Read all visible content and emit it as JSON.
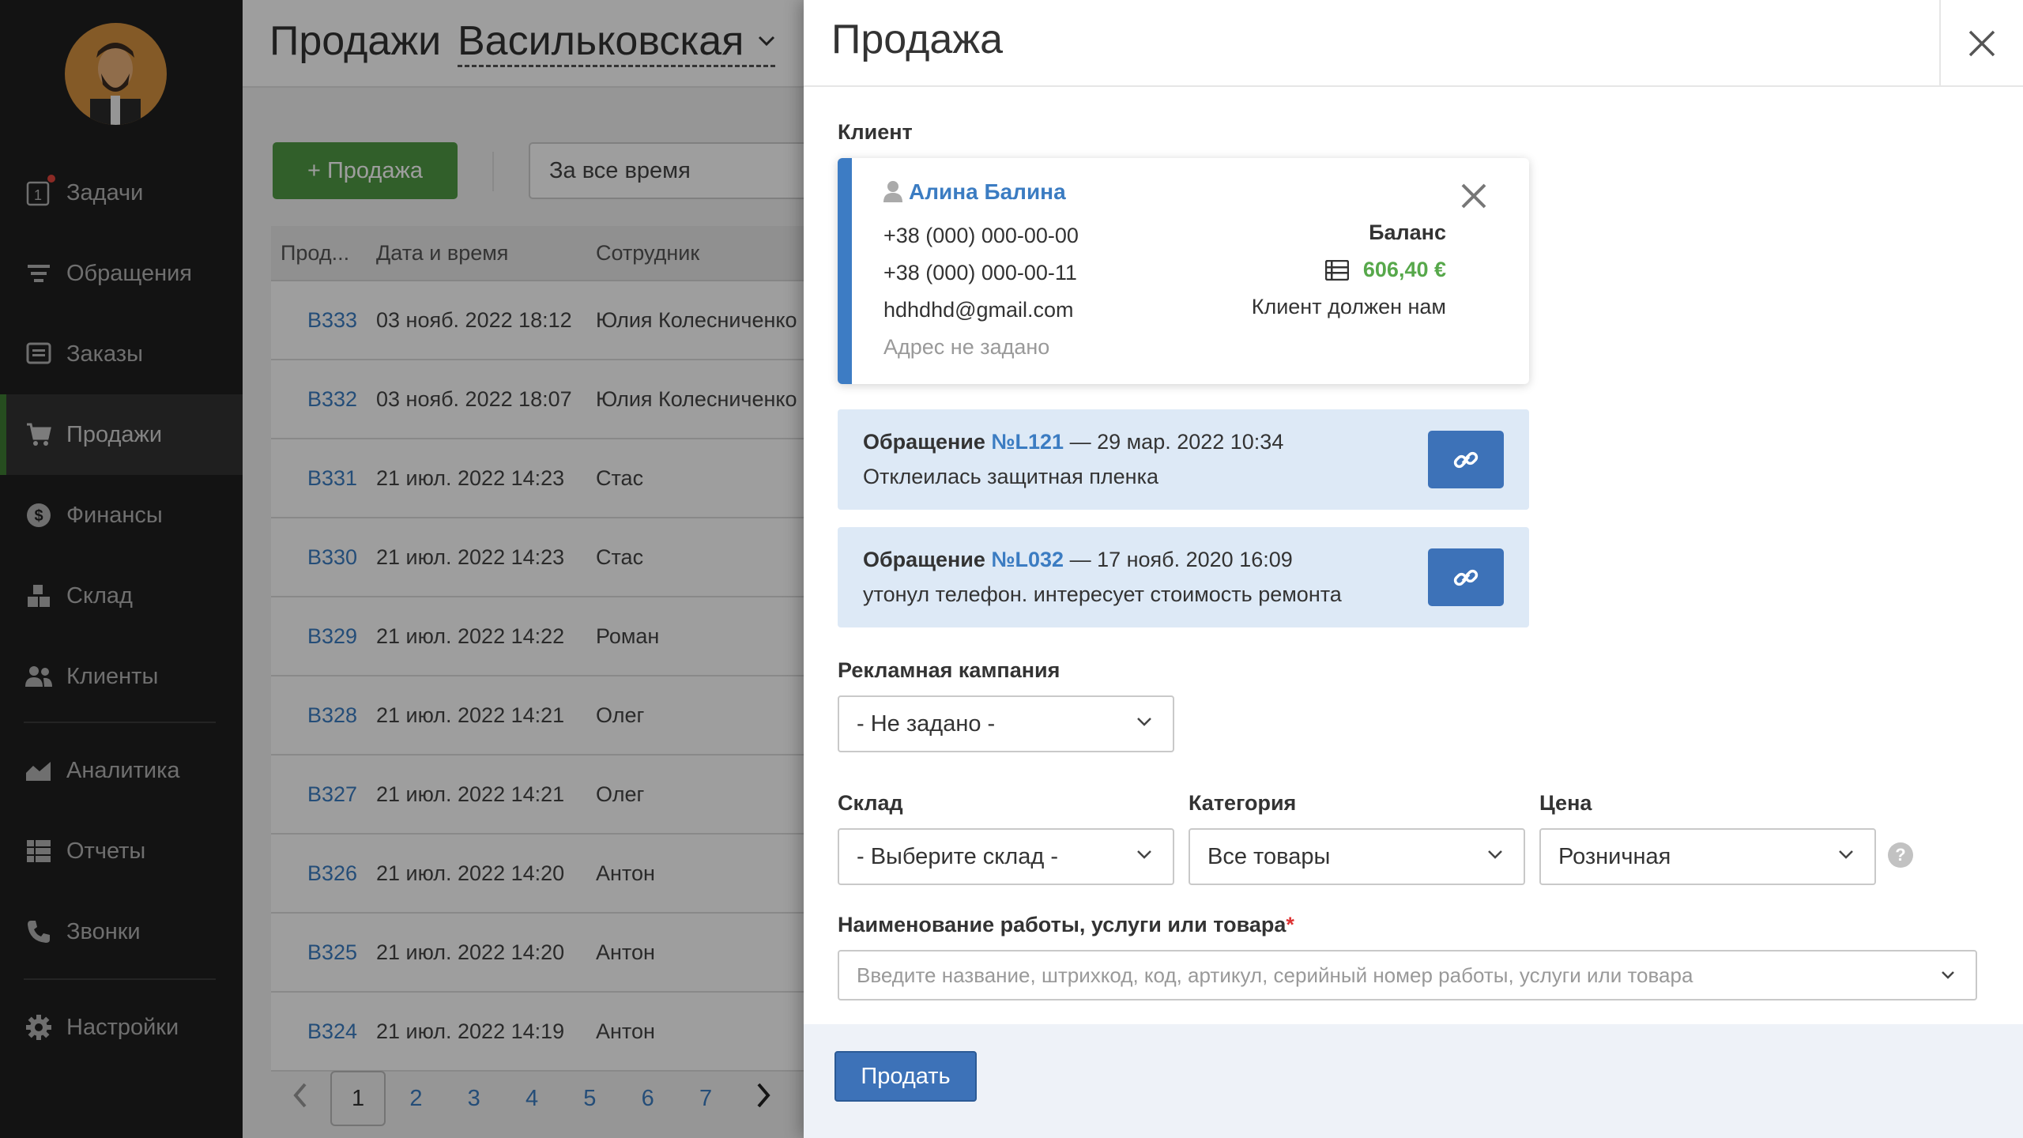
{
  "sidebar": {
    "items": [
      {
        "label": "Задачи",
        "icon": "tasks-icon"
      },
      {
        "label": "Обращения",
        "icon": "appeals-icon"
      },
      {
        "label": "Заказы",
        "icon": "orders-icon"
      },
      {
        "label": "Продажи",
        "icon": "cart-icon",
        "active": true
      },
      {
        "label": "Финансы",
        "icon": "dollar-icon"
      },
      {
        "label": "Склад",
        "icon": "warehouse-icon"
      },
      {
        "label": "Клиенты",
        "icon": "users-icon"
      },
      {
        "label": "Аналитика",
        "icon": "chart-icon"
      },
      {
        "label": "Отчеты",
        "icon": "reports-icon"
      },
      {
        "label": "Звонки",
        "icon": "phone-icon"
      },
      {
        "label": "Настройки",
        "icon": "gear-icon"
      }
    ],
    "tasks_badge_color": "#e0443c",
    "active_color": "#3e7d32"
  },
  "main": {
    "title": "Продажи",
    "store": "Васильковская",
    "add_button": "+  Продажа",
    "period_filter": "За все время",
    "columns": [
      "Прод...",
      "Дата и время",
      "Сотрудник"
    ],
    "rows": [
      [
        "В333",
        "03 нояб. 2022 18:12",
        "Юлия Колесниченко"
      ],
      [
        "В332",
        "03 нояб. 2022 18:07",
        "Юлия Колесниченко"
      ],
      [
        "В331",
        "21 июл. 2022 14:23",
        "Стас"
      ],
      [
        "В330",
        "21 июл. 2022 14:23",
        "Стас"
      ],
      [
        "В329",
        "21 июл. 2022 14:22",
        "Роман"
      ],
      [
        "В328",
        "21 июл. 2022 14:21",
        "Олег"
      ],
      [
        "В327",
        "21 июл. 2022 14:21",
        "Олег"
      ],
      [
        "В326",
        "21 июл. 2022 14:20",
        "Антон"
      ],
      [
        "В325",
        "21 июл. 2022 14:20",
        "Антон"
      ],
      [
        "В324",
        "21 июл. 2022 14:19",
        "Антон"
      ]
    ],
    "pages": [
      "1",
      "2",
      "3",
      "4",
      "5",
      "6",
      "7"
    ],
    "current_page": "1"
  },
  "drawer": {
    "title": "Продажа",
    "client_label": "Клиент",
    "client": {
      "name": "Алина Балина",
      "phone1": "+38 (000) 000-00-00",
      "phone2": "+38 (000) 000-00-11",
      "email": "hdhdhd@gmail.com",
      "address": "Адрес не задано",
      "balance_label": "Баланс",
      "balance_value": "606,40 €",
      "balance_note": "Клиент должен нам"
    },
    "appeals": [
      {
        "prefix": "Обращение",
        "number": "№L121",
        "date": " — 29 мар. 2022 10:34",
        "text": "Отклеилась защитная пленка"
      },
      {
        "prefix": "Обращение",
        "number": "№L032",
        "date": " — 17 нояб. 2020 16:09",
        "text": "утонул телефон. интересует стоимость ремонта"
      }
    ],
    "campaign_label": "Рекламная кампания",
    "campaign_value": "- Не задано -",
    "warehouse_label": "Склад",
    "warehouse_value": "- Выберите склад -",
    "category_label": "Категория",
    "category_value": "Все товары",
    "price_label": "Цена",
    "price_value": "Розничная",
    "help": "?",
    "item_label": "Наименование работы, услуги или товара",
    "required_mark": "*",
    "item_placeholder": "Введите название, штрихкод, код, артикул, серийный номер работы, услуги или товара",
    "submit": "Продать"
  }
}
